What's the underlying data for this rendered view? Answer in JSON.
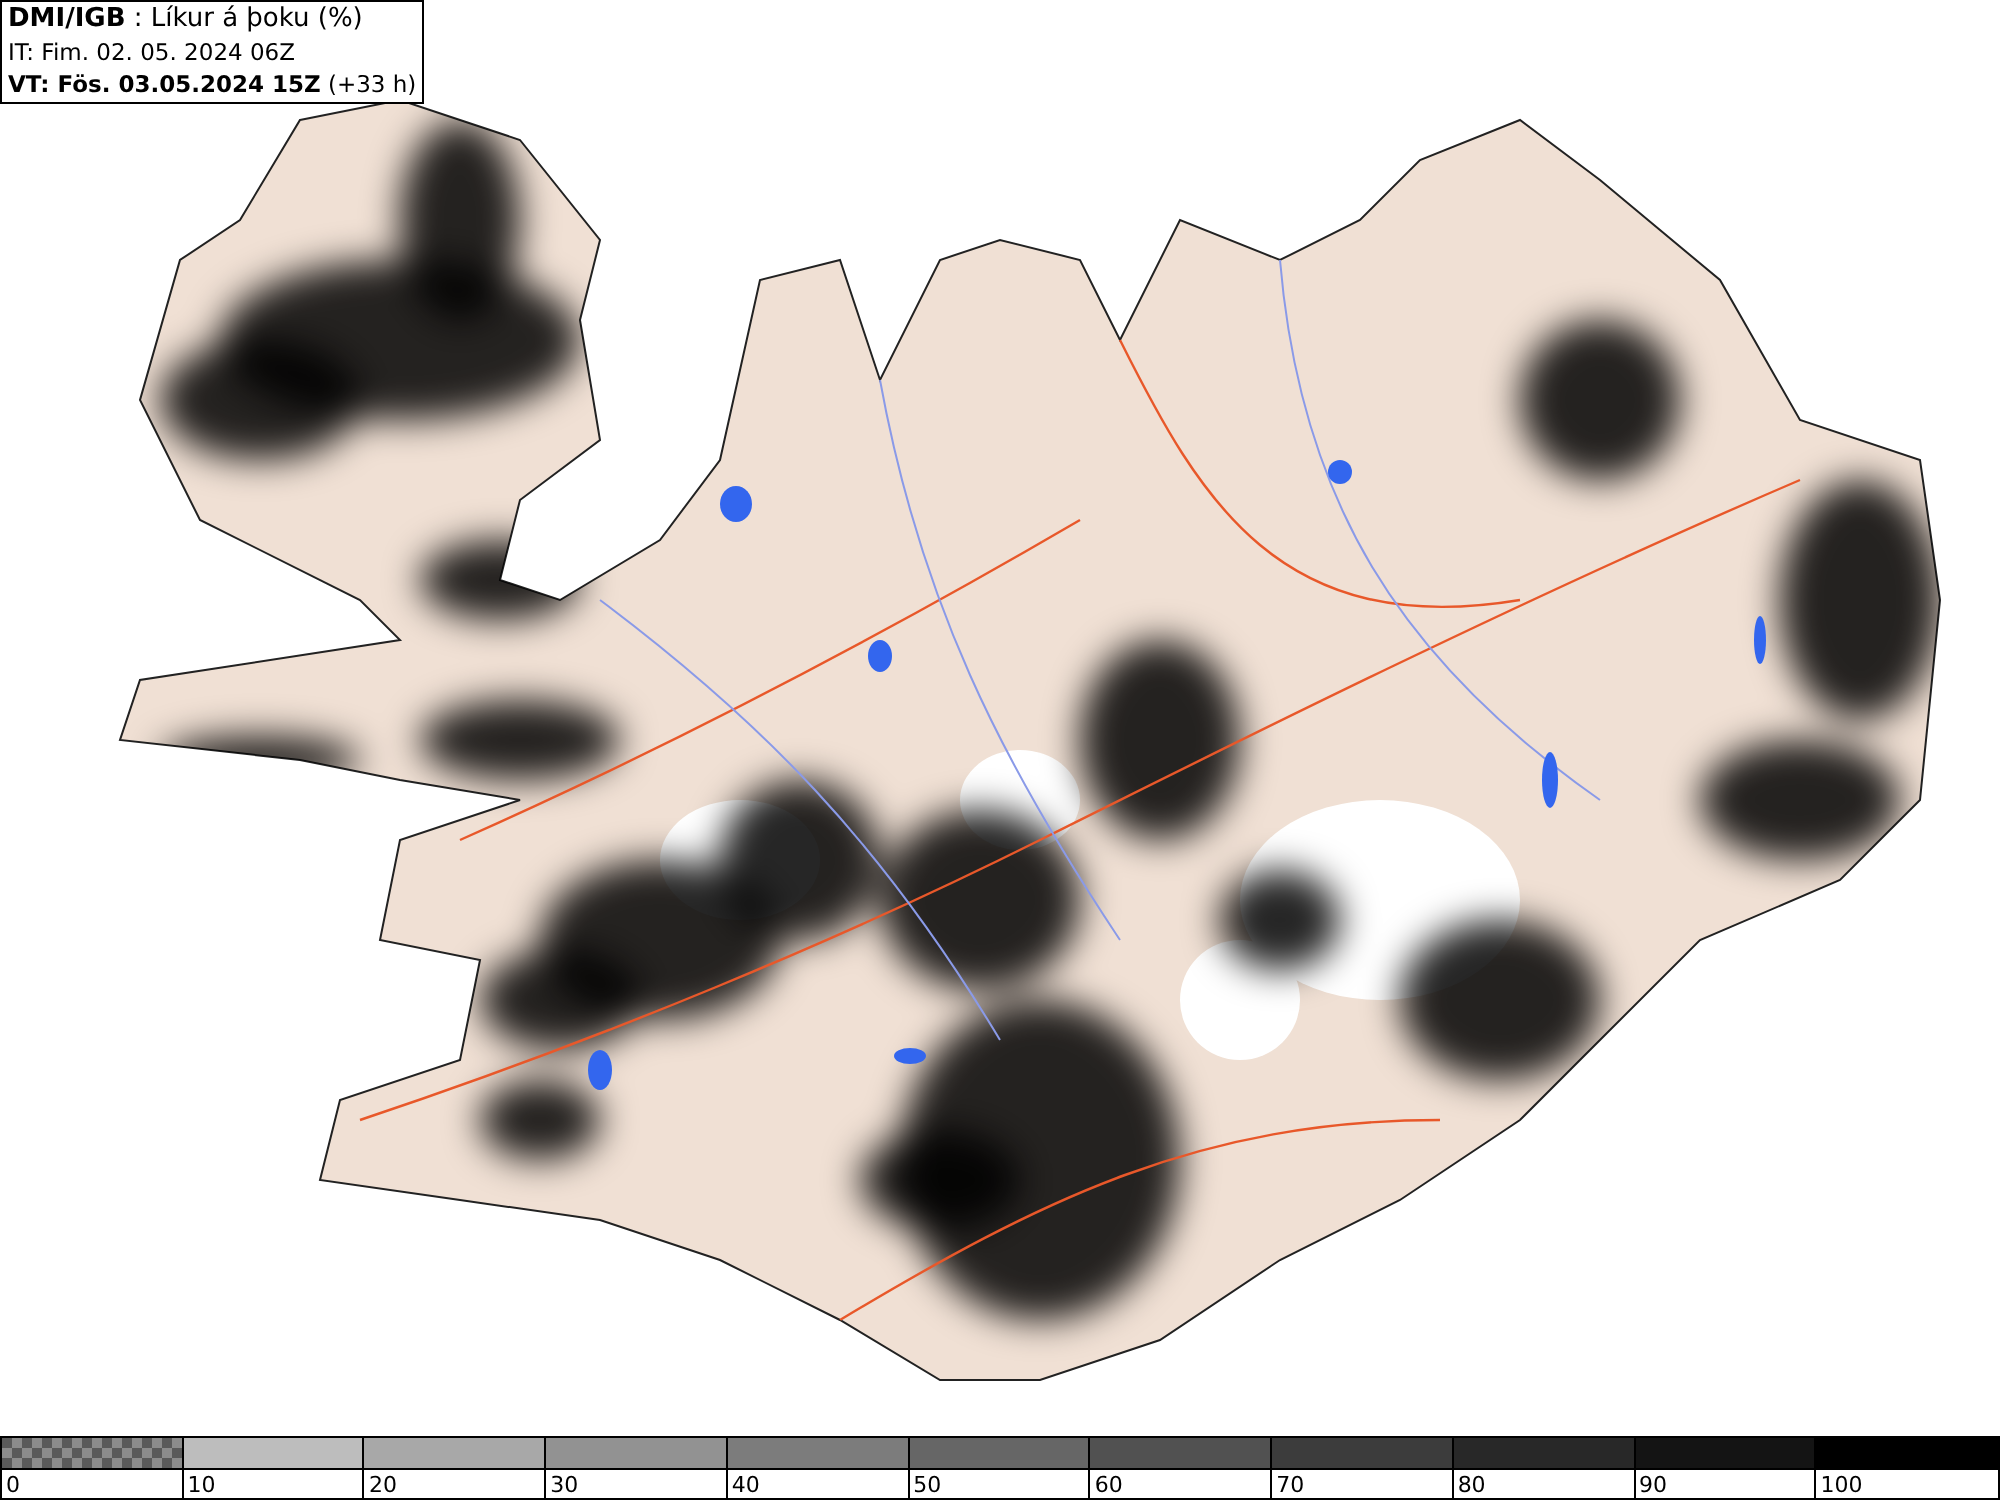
{
  "header": {
    "title": "**DMI/IGB** : Líkur á þoku (%)",
    "issue_time": "IT: Fim. 02. 05. 2024 06Z",
    "valid_time": "**VT: Fös. 03.05.2024 15Z** (+33 h)"
  },
  "legend": {
    "bins": [
      {
        "label": "0",
        "kind": "checker",
        "color": "#8c8c8c"
      },
      {
        "label": "10",
        "kind": "solid",
        "color": "#bdbdbd"
      },
      {
        "label": "20",
        "kind": "solid",
        "color": "#a8a8a8"
      },
      {
        "label": "30",
        "kind": "solid",
        "color": "#929292"
      },
      {
        "label": "40",
        "kind": "solid",
        "color": "#7c7c7c"
      },
      {
        "label": "50",
        "kind": "solid",
        "color": "#666666"
      },
      {
        "label": "60",
        "kind": "solid",
        "color": "#515151"
      },
      {
        "label": "70",
        "kind": "solid",
        "color": "#3c3c3c"
      },
      {
        "label": "80",
        "kind": "solid",
        "color": "#282828"
      },
      {
        "label": "90",
        "kind": "solid",
        "color": "#141414"
      },
      {
        "label": "100",
        "kind": "solid",
        "color": "#000000"
      }
    ]
  }
}
